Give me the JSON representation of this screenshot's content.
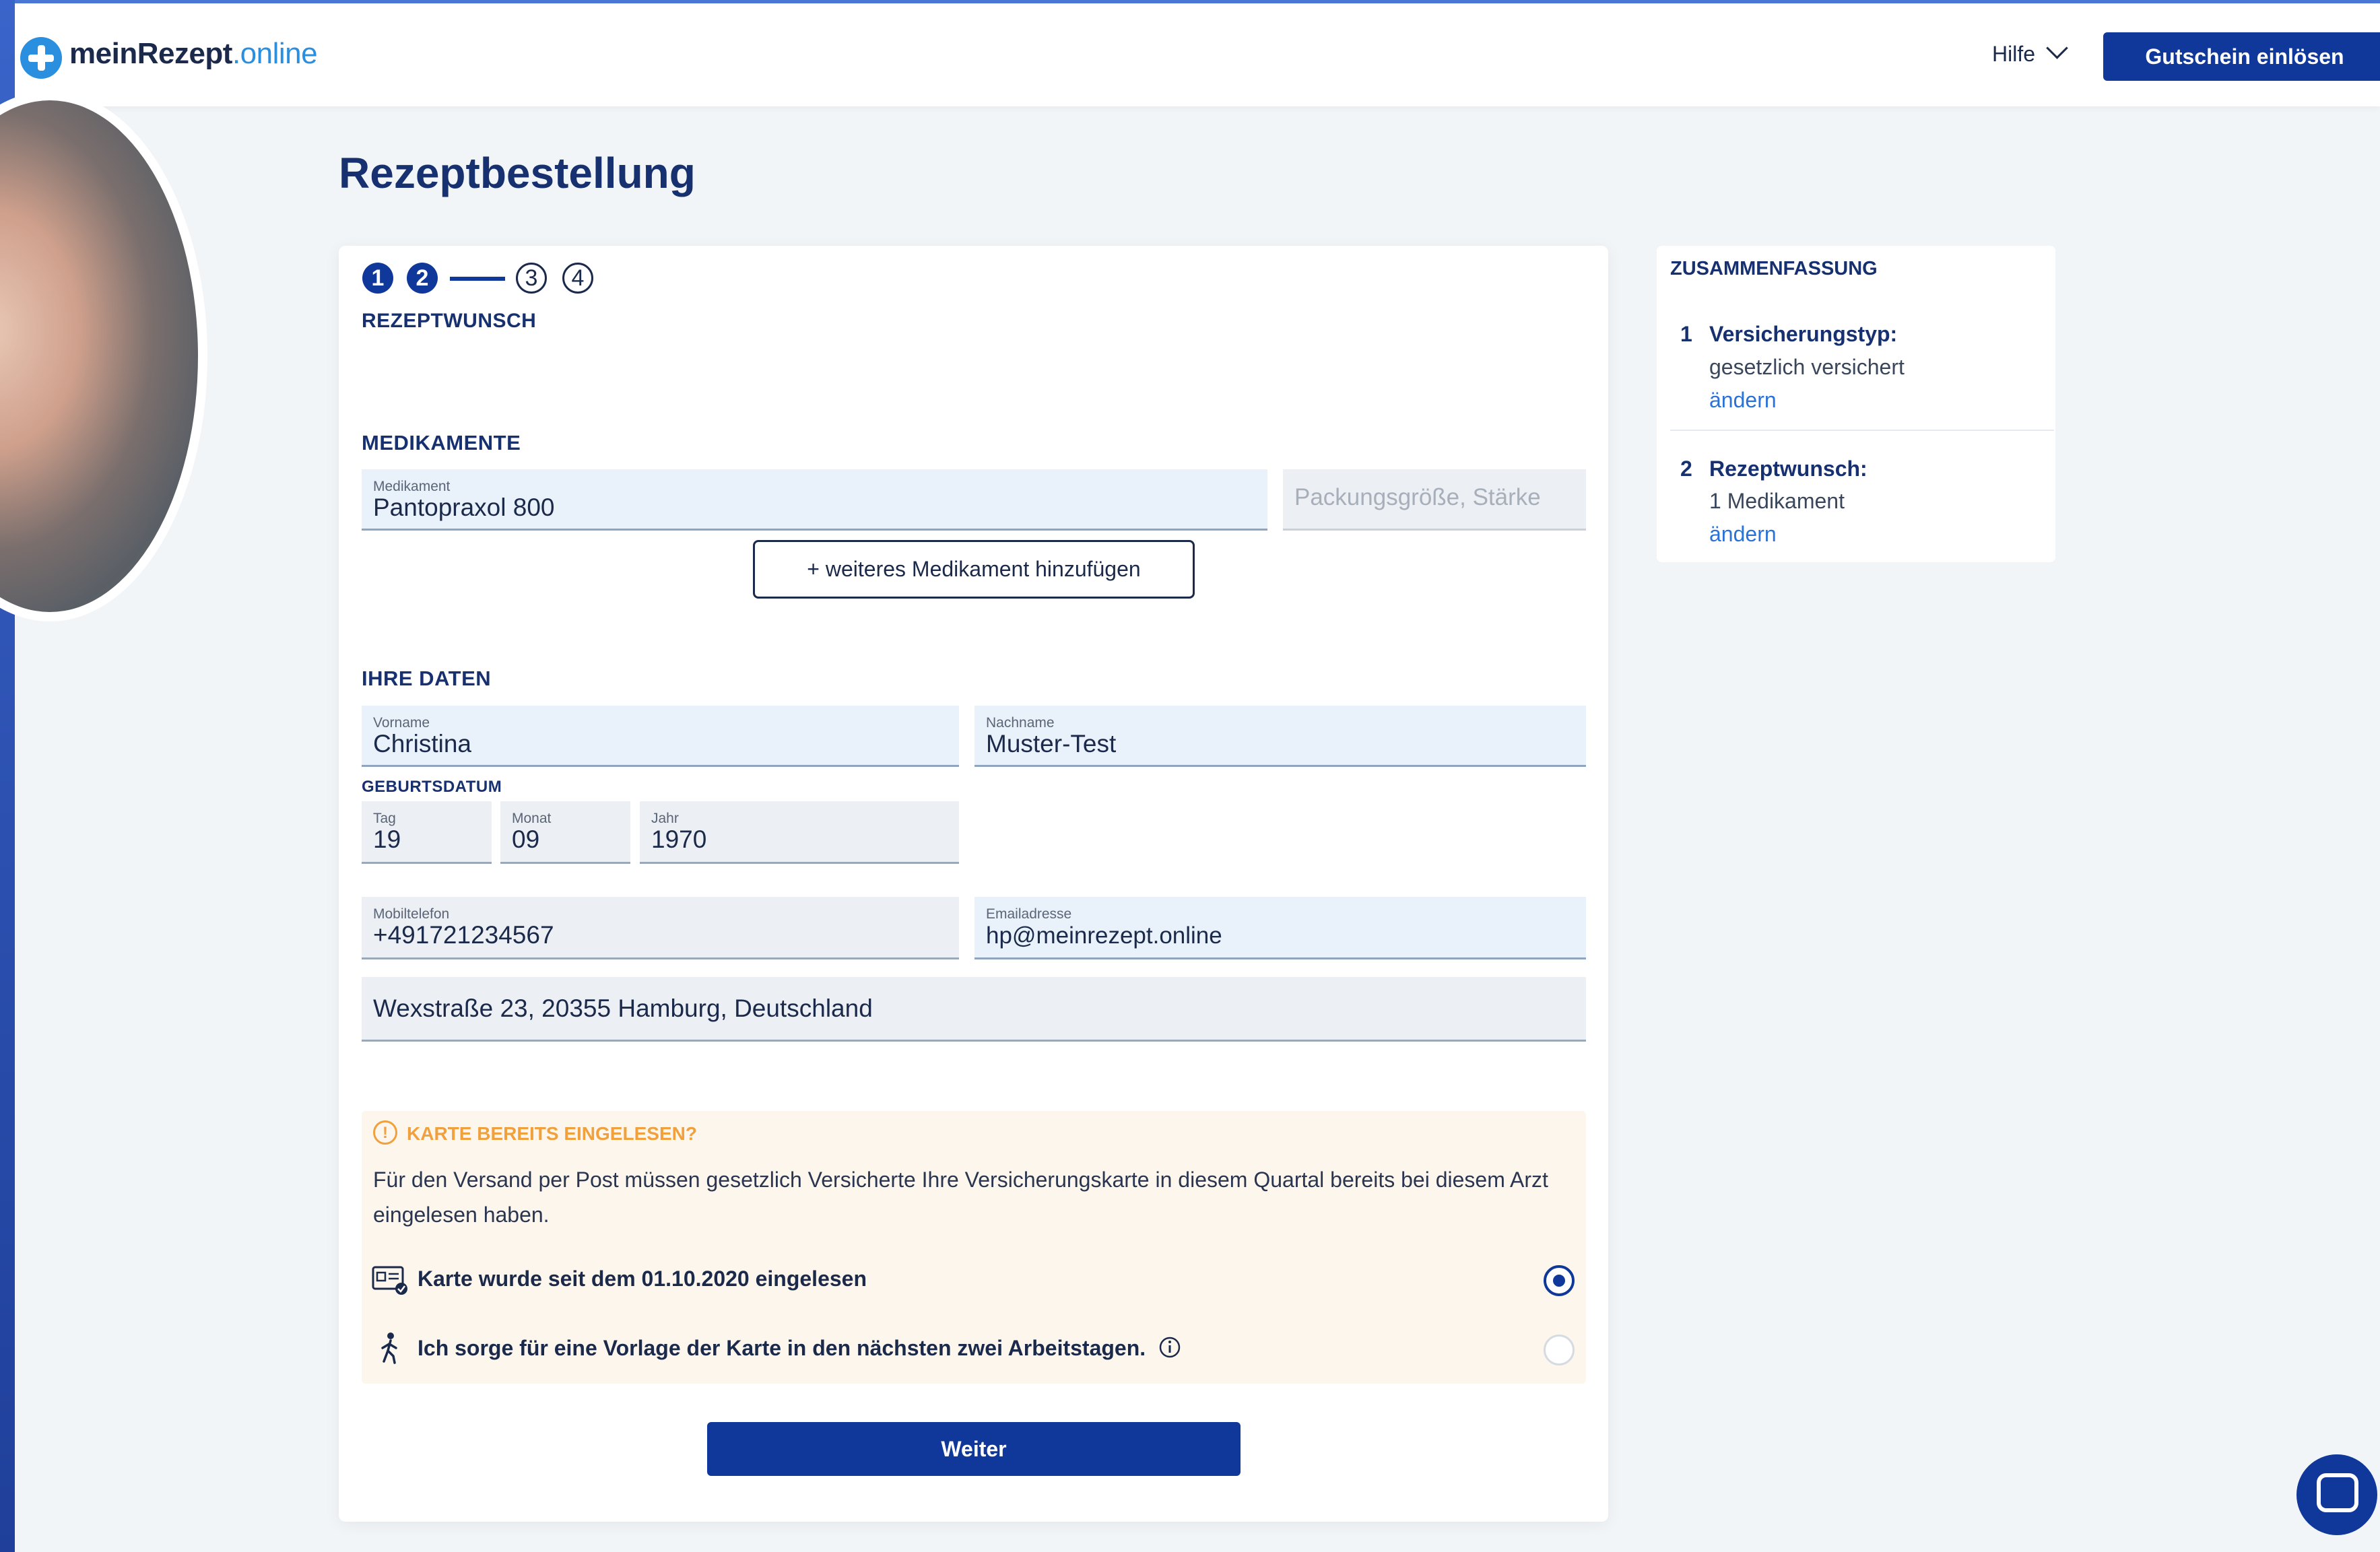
{
  "brand": {
    "name": "meinRezept",
    "tld": ".online"
  },
  "header": {
    "help_label": "Hilfe",
    "voucher_button": "Gutschein einlösen"
  },
  "page": {
    "title": "Rezeptbestellung"
  },
  "stepper": {
    "steps": [
      "1",
      "2",
      "3",
      "4"
    ],
    "current_label": "REZEPTWUNSCH"
  },
  "medications": {
    "section_title": "MEDIKAMENTE",
    "drug_label": "Medikament",
    "drug_value": "Pantopraxol 800",
    "size_placeholder": "Packungsgröße, Stärke",
    "add_button": "+ weiteres Medikament hinzufügen"
  },
  "personal": {
    "section_title": "IHRE DATEN",
    "firstname_label": "Vorname",
    "firstname_value": "Christina",
    "lastname_label": "Nachname",
    "lastname_value": "Muster-Test",
    "birthdate_title": "GEBURTSDATUM",
    "day_label": "Tag",
    "day_value": "19",
    "month_label": "Monat",
    "month_value": "09",
    "year_label": "Jahr",
    "year_value": "1970",
    "phone_label": "Mobiltelefon",
    "phone_value": "+491721234567",
    "email_label": "Emailadresse",
    "email_value": "hp@meinrezept.online",
    "address_value": "Wexstraße 23, 20355 Hamburg, Deutschland"
  },
  "notice": {
    "title": "KARTE BEREITS EINGELESEN?",
    "text": "Für den Versand per Post müssen gesetzlich Versicherte Ihre Versicherungskarte in diesem Quartal bereits bei diesem Arzt eingelesen haben.",
    "option1": "Karte wurde seit dem 01.10.2020 eingelesen",
    "option2": "Ich sorge für eine Vorlage der Karte in den nächsten zwei Arbeitstagen.",
    "selected_option": 1
  },
  "submit_label": "Weiter",
  "summary": {
    "title": "ZUSAMMENFASSUNG",
    "items": [
      {
        "num": "1",
        "heading": "Versicherungstyp:",
        "value": "gesetzlich versichert",
        "link": "ändern"
      },
      {
        "num": "2",
        "heading": "Rezeptwunsch:",
        "value": "1 Medikament",
        "link": "ändern"
      }
    ]
  },
  "colors": {
    "primary": "#10389a",
    "accent": "#2b8fe0",
    "warning": "#f0a03c",
    "link": "#2b72d8"
  },
  "icons": [
    "logo-cross-icon",
    "chevron-down-icon",
    "info-icon",
    "card-reader-icon",
    "walking-person-icon",
    "chat-icon"
  ]
}
